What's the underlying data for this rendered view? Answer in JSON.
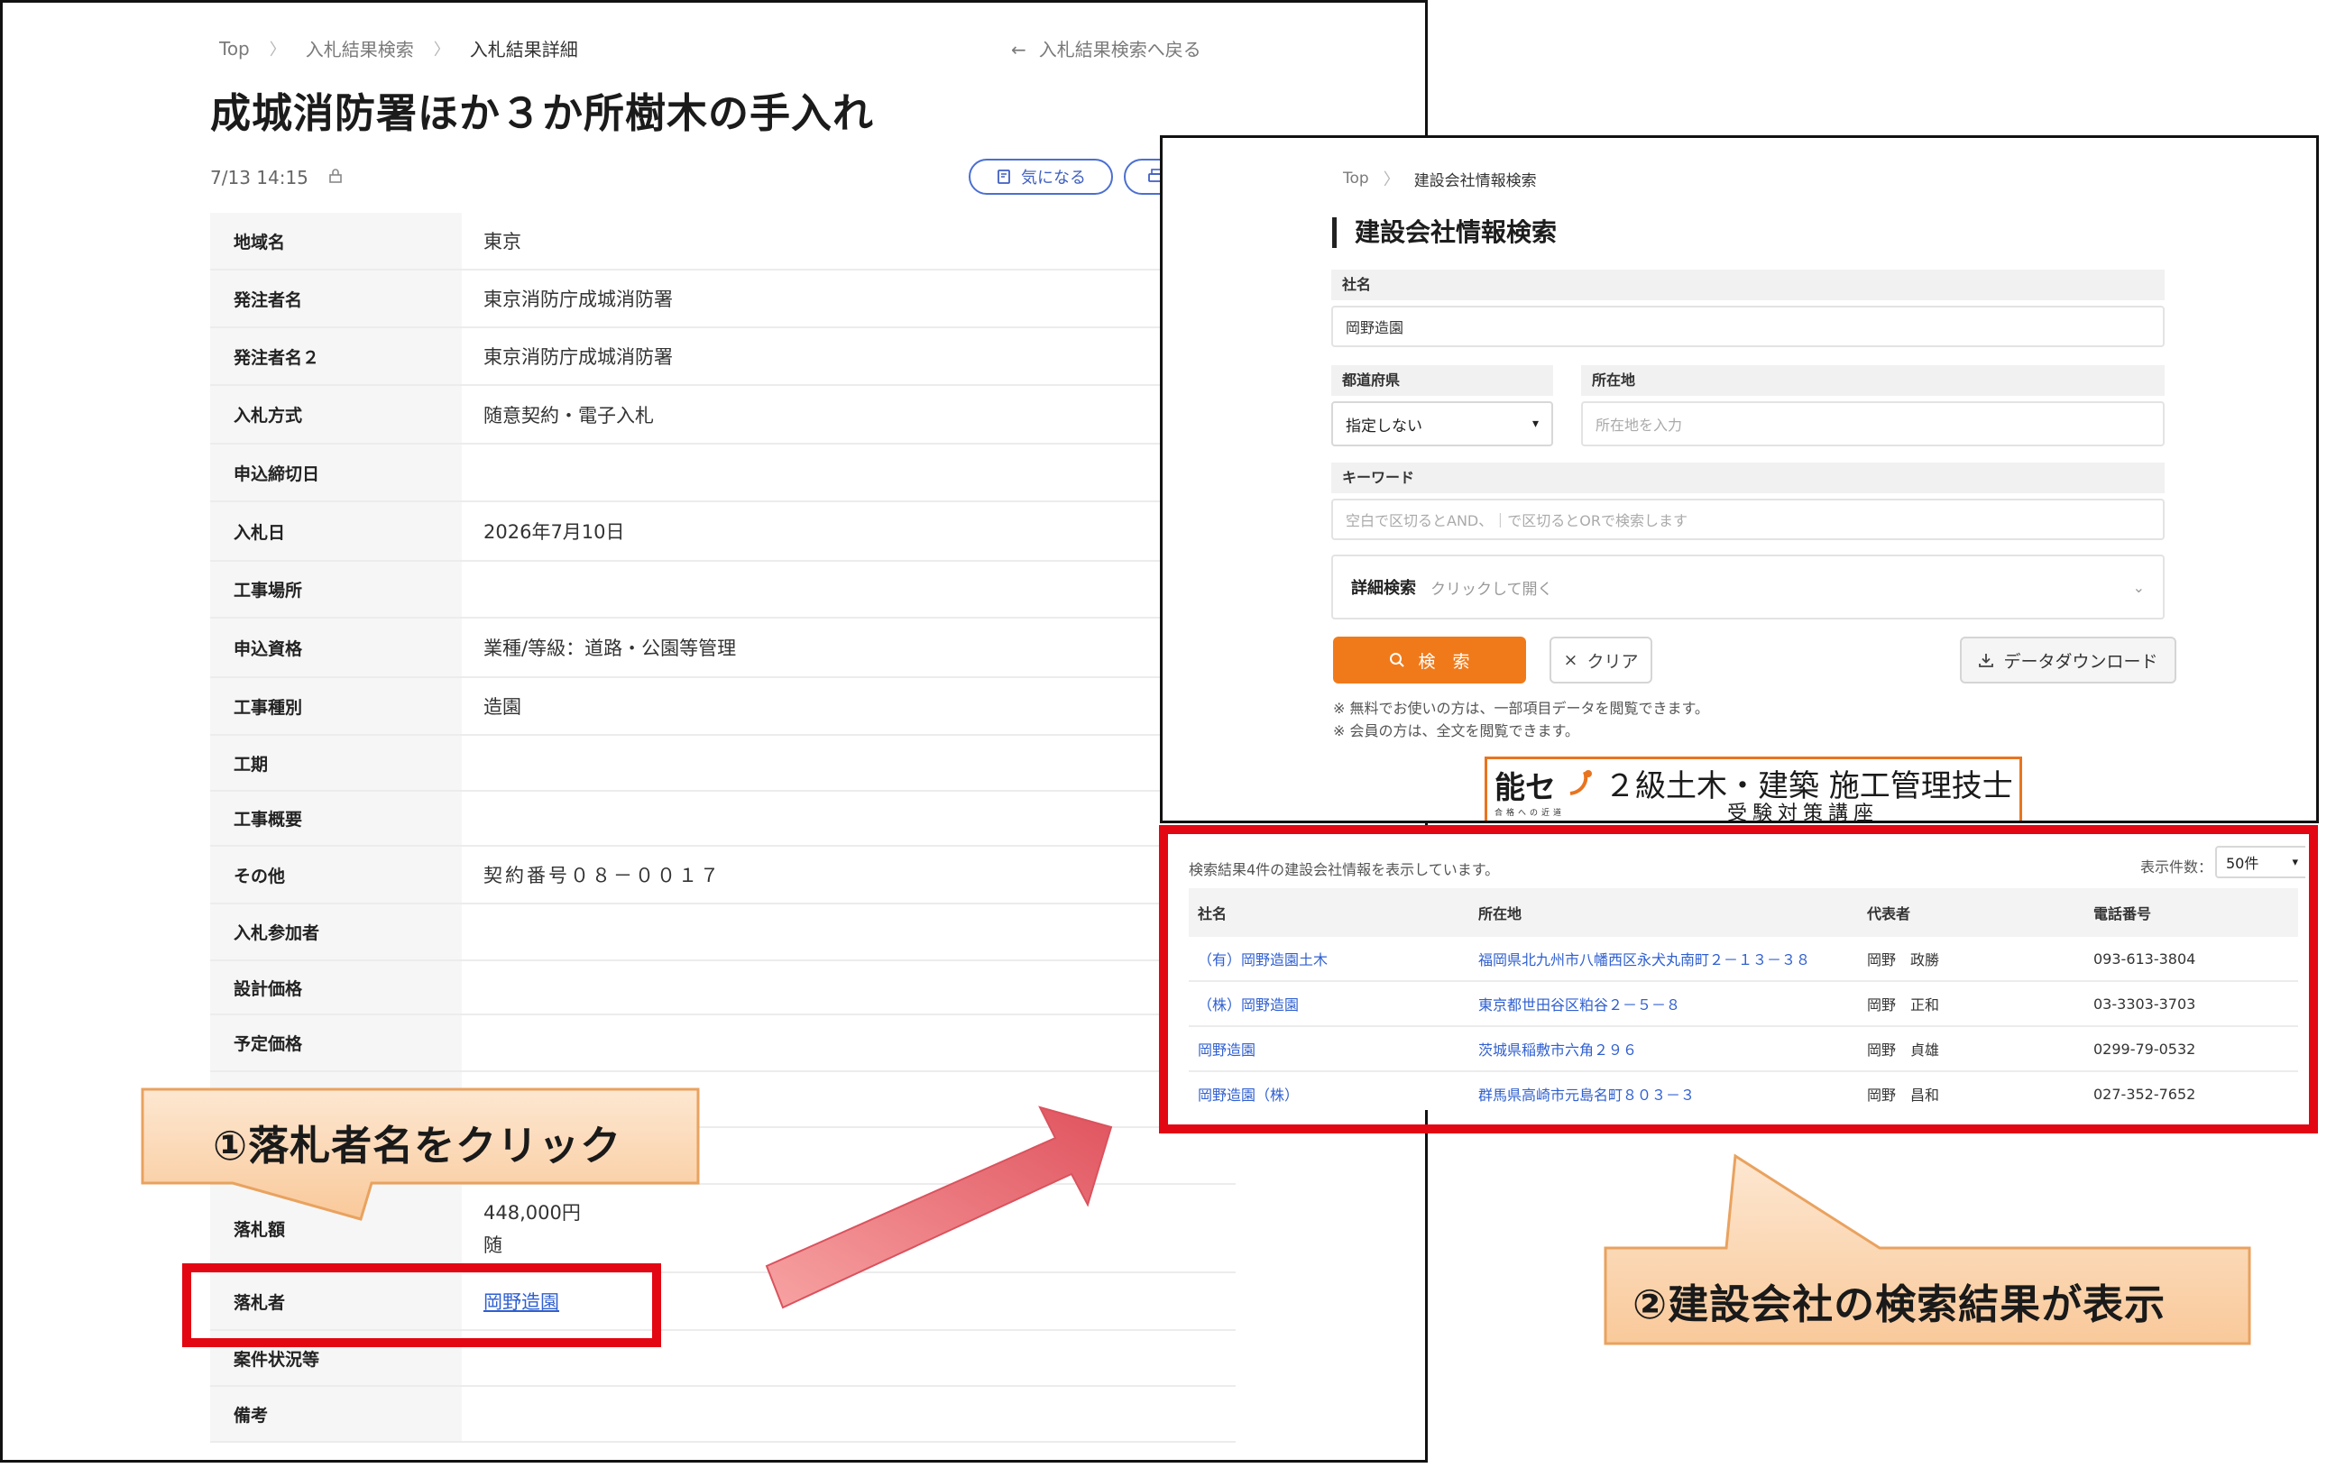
{
  "left_page": {
    "breadcrumb": [
      "Top",
      "入札結果検索",
      "入札結果詳細"
    ],
    "back_link": "入札結果検索へ戻る",
    "title": "成城消防署ほか３か所樹木の手入れ",
    "timestamp": "7/13 14:15",
    "favorite_button": "気になる",
    "rows": [
      {
        "k": "地域名",
        "v": "東京"
      },
      {
        "k": "発注者名",
        "v": "東京消防庁成城消防署"
      },
      {
        "k": "発注者名２",
        "v": "東京消防庁成城消防署"
      },
      {
        "k": "入札方式",
        "v": "随意契約・電子入札"
      },
      {
        "k": "申込締切日",
        "v": ""
      },
      {
        "k": "入札日",
        "v": "2026年7月10日"
      },
      {
        "k": "工事場所",
        "v": ""
      },
      {
        "k": "申込資格",
        "v": "業種/等級：道路・公園等管理"
      },
      {
        "k": "工事種別",
        "v": "造園"
      },
      {
        "k": "工期",
        "v": ""
      },
      {
        "k": "工事概要",
        "v": ""
      },
      {
        "k": "その他",
        "v": "契約番号０８－００１７"
      },
      {
        "k": "入札参加者",
        "v": ""
      },
      {
        "k": "設計価格",
        "v": ""
      },
      {
        "k": "予定価格",
        "v": ""
      },
      {
        "k": "",
        "v": ""
      },
      {
        "k": "",
        "v": ""
      },
      {
        "k": "落札額",
        "v": "448,000円"
      },
      {
        "k": "落札者",
        "v": "岡野造園"
      },
      {
        "k": "案件状況等",
        "v": ""
      },
      {
        "k": "備考",
        "v": ""
      }
    ],
    "price_note": "随"
  },
  "right_page": {
    "breadcrumb": [
      "Top",
      "建設会社情報検索"
    ],
    "title": "建設会社情報検索",
    "company_label": "社名",
    "company_value": "岡野造園",
    "pref_label": "都道府県",
    "pref_value": "指定しない",
    "address_label": "所在地",
    "address_placeholder": "所在地を入力",
    "keyword_label": "キーワード",
    "keyword_placeholder": "空白で区切るとAND、｜で区切るとORで検索します",
    "detail_label": "詳細検索",
    "detail_hint": "クリックして開く",
    "search_button": "検　索",
    "clear_button": "クリア",
    "download_button": "データダウンロード",
    "note1": "※ 無料でお使いの方は、一部項目データを閲覧できます。",
    "note2": "※ 会員の方は、全文を閲覧できます。",
    "banner": {
      "logo": "能セ",
      "logo_sub": "合格への近道",
      "title": "２級土木・建築 施工管理技士",
      "subtitle": "受験対策講座"
    },
    "results": {
      "info": "検索結果4件の建設会社情報を表示しています。",
      "count_label": "表示件数：",
      "count_value": "50件",
      "headers": [
        "社名",
        "所在地",
        "代表者",
        "電話番号"
      ],
      "rows": [
        [
          "（有）岡野造園土木",
          "福岡県北九州市八幡西区永犬丸南町２－１３－３８",
          "岡野　政勝",
          "093-613-3804"
        ],
        [
          "（株）岡野造園",
          "東京都世田谷区粕谷２－５－８",
          "岡野　正和",
          "03-3303-3703"
        ],
        [
          "岡野造園",
          "茨城県稲敷市六角２９６",
          "岡野　貞雄",
          "0299-79-0532"
        ],
        [
          "岡野造園（株）",
          "群馬県高崎市元島名町８０３－３",
          "岡野　昌和",
          "027-352-7652"
        ]
      ]
    }
  },
  "callouts": {
    "step1": "①落札者名をクリック",
    "step2": "②建設会社の検索結果が表示"
  },
  "colors": {
    "highlight": "#e30613",
    "callout_fill": "#fbd8b4",
    "callout_stroke": "#e9a25f",
    "link": "#2f5fd0",
    "search_button": "#f07a1a"
  }
}
